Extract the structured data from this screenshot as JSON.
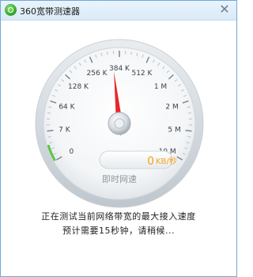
{
  "window": {
    "title": "360宽带测速器",
    "close_glyph": "✕"
  },
  "gauge": {
    "ticks": [
      "0",
      "7 K",
      "64 K",
      "128 K",
      "256 K",
      "384 K",
      "512 K",
      "1 M",
      "2 M",
      "5 M",
      "10 M"
    ],
    "speed_value": "0",
    "speed_unit": "KB/秒",
    "caption": "即时网速",
    "needle_tick_position": 4.75,
    "accent_color": "#e8262b",
    "value_color": "#f5a21b"
  },
  "status": {
    "line1": "正在测试当前网络带宽的最大接入速度",
    "line2": "预计需要15秒钟，请稍候..."
  }
}
